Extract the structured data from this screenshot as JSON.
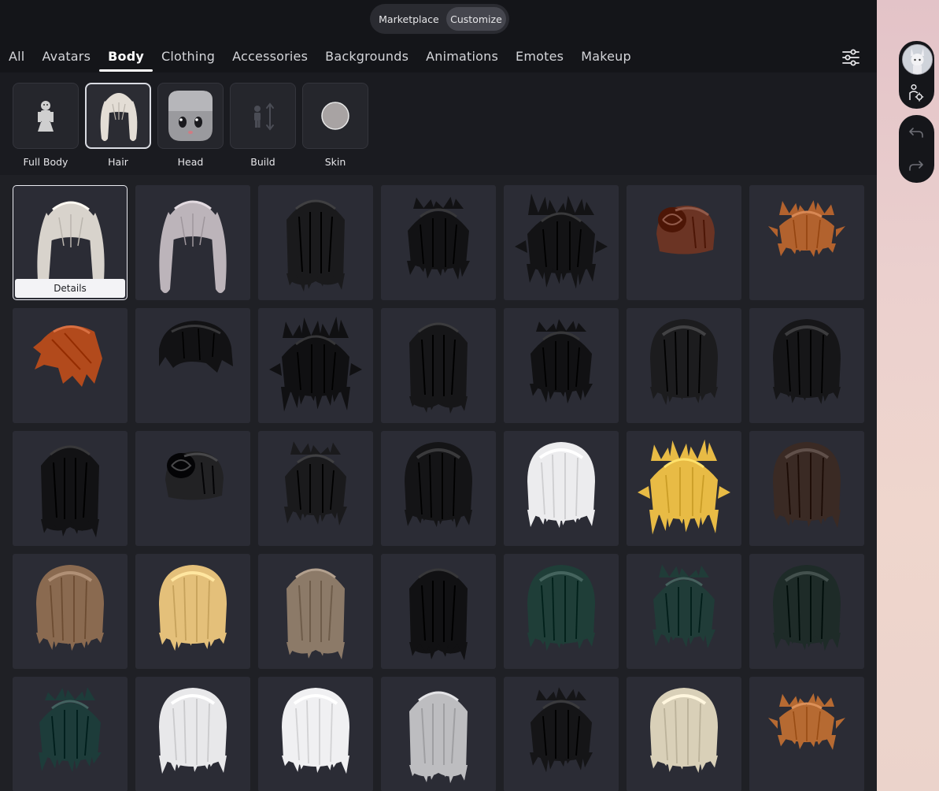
{
  "mode_toggle": {
    "marketplace": "Marketplace",
    "customize": "Customize",
    "selected": "Customize"
  },
  "tabs": [
    "All",
    "Avatars",
    "Body",
    "Clothing",
    "Accessories",
    "Backgrounds",
    "Animations",
    "Emotes",
    "Makeup"
  ],
  "active_tab": "Body",
  "subcategories": [
    {
      "label": "Full Body",
      "icon": "full-body-figure-icon"
    },
    {
      "label": "Hair",
      "icon": "white-pigtails-hair-icon"
    },
    {
      "label": "Head",
      "icon": "anime-head-icon"
    },
    {
      "label": "Build",
      "icon": "body-scale-icon"
    },
    {
      "label": "Skin",
      "icon": "skin-tone-swatch-icon"
    }
  ],
  "active_subcategory": "Hair",
  "skin_color": "#a8a3a3",
  "details_label": "Details",
  "selected_item": 0,
  "hair_items": [
    {
      "name": "white-pigtails",
      "style": "pigtails",
      "color": "#d8d3cc"
    },
    {
      "name": "silver-pigtails",
      "style": "pigtails",
      "color": "#bcb4ba"
    },
    {
      "name": "black-long-side",
      "style": "long",
      "color": "#1a1a1c"
    },
    {
      "name": "black-shag",
      "style": "messy",
      "color": "#121214"
    },
    {
      "name": "black-spiky-shag",
      "style": "spiky",
      "color": "#131315"
    },
    {
      "name": "brown-bun",
      "style": "bun",
      "color": "#6b3424"
    },
    {
      "name": "ginger-spiky",
      "style": "spiky-small",
      "color": "#b2622e"
    },
    {
      "name": "orange-swept",
      "style": "swept",
      "color": "#b24a1c"
    },
    {
      "name": "black-short-wave",
      "style": "short",
      "color": "#121214"
    },
    {
      "name": "black-wild-long",
      "style": "spiky",
      "color": "#101012"
    },
    {
      "name": "black-layered-long",
      "style": "long",
      "color": "#161618"
    },
    {
      "name": "black-messy-short",
      "style": "messy",
      "color": "#111113"
    },
    {
      "name": "black-emo-long",
      "style": "mop",
      "color": "#1c1c1e"
    },
    {
      "name": "black-mop",
      "style": "mop",
      "color": "#161618"
    },
    {
      "name": "black-fringe-long",
      "style": "long",
      "color": "#121214"
    },
    {
      "name": "black-bun-glasses",
      "style": "bun",
      "color": "#222224"
    },
    {
      "name": "black-small-messy",
      "style": "messy",
      "color": "#1a1a1c"
    },
    {
      "name": "black-fluffy",
      "style": "mop",
      "color": "#141416"
    },
    {
      "name": "white-fluffy",
      "style": "mop",
      "color": "#ececee"
    },
    {
      "name": "golden-spiky",
      "style": "spiky",
      "color": "#e8bb45"
    },
    {
      "name": "dark-brown-messy",
      "style": "mop",
      "color": "#3a2a24"
    },
    {
      "name": "light-brown-wavy",
      "style": "mop",
      "color": "#8a6a50"
    },
    {
      "name": "blonde-red-ombre",
      "style": "mop",
      "color": "#e4c07a"
    },
    {
      "name": "ash-brown-long",
      "style": "long",
      "color": "#8c7a68"
    },
    {
      "name": "black-straight",
      "style": "long",
      "color": "#111113"
    },
    {
      "name": "dark-teal-messy",
      "style": "mop",
      "color": "#1f3e38"
    },
    {
      "name": "dark-teal-short",
      "style": "messy",
      "color": "#203c38"
    },
    {
      "name": "dark-green-side",
      "style": "mop",
      "color": "#1e2b28"
    },
    {
      "name": "teal-fluffy",
      "style": "messy",
      "color": "#1d3c3a"
    },
    {
      "name": "white-layered",
      "style": "mop",
      "color": "#e8e8ea"
    },
    {
      "name": "white-messy",
      "style": "mop",
      "color": "#f0f0f2"
    },
    {
      "name": "gray-long-shag",
      "style": "long",
      "color": "#bdbdc0"
    },
    {
      "name": "black-tuft",
      "style": "messy",
      "color": "#151517"
    },
    {
      "name": "cream-shag",
      "style": "mop",
      "color": "#d9d0b8"
    },
    {
      "name": "ginger-spike",
      "style": "spiky-small",
      "color": "#b66a32"
    }
  ],
  "right_panel": {
    "avatar_icon": "avatar-thumbnail",
    "settings_icon": "avatar-settings-icon",
    "undo_icon": "undo-icon",
    "redo_icon": "redo-icon"
  }
}
